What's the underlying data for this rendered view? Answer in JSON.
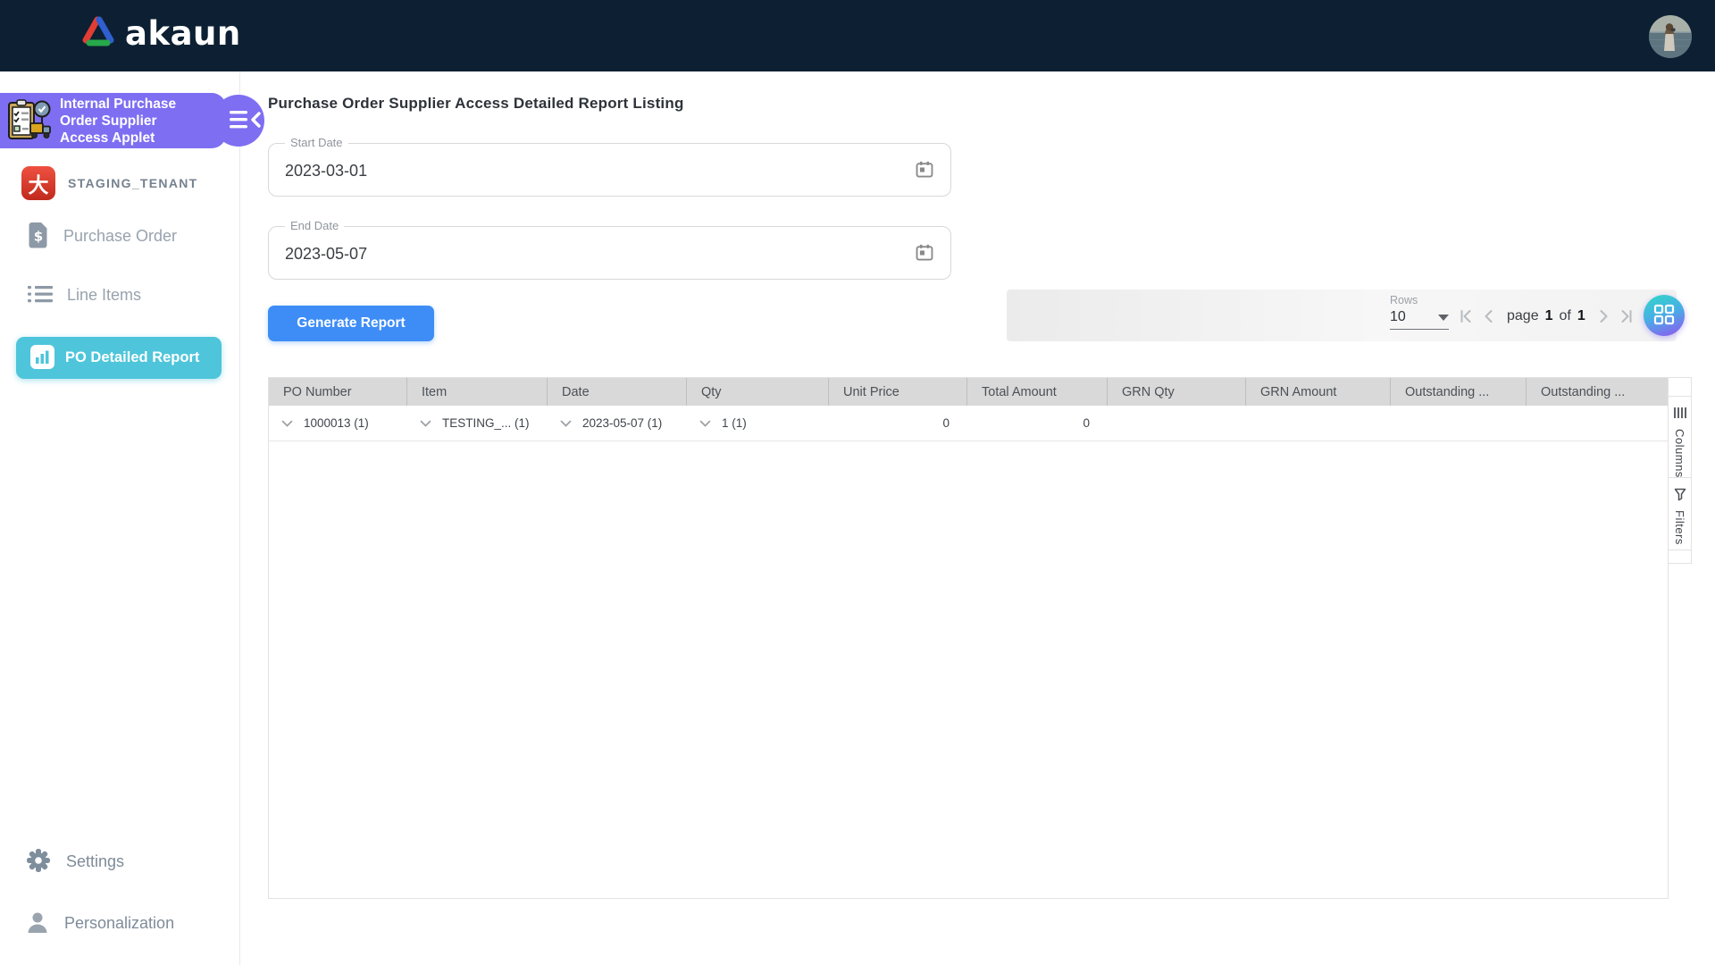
{
  "topbar": {
    "brand": "akaun"
  },
  "sidebar": {
    "applet_title_lines": [
      "Internal Purchase",
      "Order Supplier",
      "Access Applet"
    ],
    "items": [
      {
        "label": "STAGING_TENANT"
      },
      {
        "label": "Purchase Order"
      },
      {
        "label": "Line Items"
      },
      {
        "label": "PO Detailed Report"
      }
    ],
    "footer_items": [
      {
        "label": "Settings"
      },
      {
        "label": "Personalization"
      }
    ]
  },
  "main": {
    "title": "Purchase Order Supplier Access Detailed Report Listing",
    "filters": {
      "start_date": {
        "label": "Start Date",
        "value": "2023-03-01"
      },
      "end_date": {
        "label": "End Date",
        "value": "2023-05-07"
      }
    },
    "generate_button_label": "Generate Report",
    "toolbar": {
      "rows_label": "Rows",
      "rows_value": "10",
      "page_word": "page",
      "current_page": "1",
      "of_word": "of",
      "total_pages": "1"
    },
    "table": {
      "columns": [
        "PO Number",
        "Item",
        "Date",
        "Qty",
        "Unit Price",
        "Total Amount",
        "GRN Qty",
        "GRN Amount",
        "Outstanding ...",
        "Outstanding ..."
      ],
      "rows": [
        {
          "cells": [
            "1000013 (1)",
            "TESTING_... (1)",
            "2023-05-07 (1)",
            "1 (1)",
            "0",
            "0",
            "",
            "",
            "",
            ""
          ]
        }
      ]
    },
    "side_panel": {
      "columns_label": "Columns",
      "filters_label": "Filters"
    }
  },
  "icons": {
    "tenant_icon_glyph": "大"
  },
  "colors": {
    "topbar_navy": "#0d2033",
    "applet_purple": "#7e6ef2",
    "active_teal": "#4ec5da",
    "button_blue": "#3e8df6",
    "header_gray": "#d9d9d9"
  }
}
